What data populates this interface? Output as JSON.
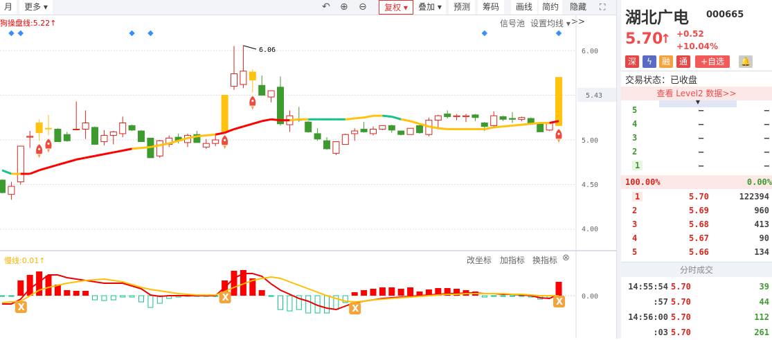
{
  "toolbar": {
    "period_month": "月",
    "more": "更多",
    "adjust": "复权",
    "overlay": "叠加",
    "forecast": "预测",
    "chips": "筹码",
    "draw": "画线",
    "simple": "简约",
    "hide": "隐藏>>",
    "icons": [
      "undo-icon",
      "zoom-in-icon",
      "zoom-out-icon",
      "fullscreen-icon"
    ]
  },
  "main_chart": {
    "indicator_label": "狗操盘线:5.22↑",
    "signal_pool": "信号池",
    "ma_settings": "设置均线",
    "max_label": "6.06",
    "current_price_label": "5.43",
    "colors": {
      "up": "#d9251c",
      "down": "#3d9a2f",
      "limit": "#ffc20e",
      "ma_up": "#ff0000",
      "ma_flat": "#ffc20e",
      "ma_down": "#13c38b",
      "signal": "#3b8cff"
    }
  },
  "lower_chart": {
    "label": "慢线:0.01↑",
    "change_axis": "改坐标",
    "add_indicator": "加指标",
    "switch_indicator": "换指标"
  },
  "chart_data": [
    {
      "type": "candlestick",
      "yticks": [
        "6.00",
        "5.00",
        "4.50",
        "4.00"
      ],
      "ylim": [
        3.8,
        6.2
      ],
      "candles": [
        [
          4.55,
          4.56,
          4.4,
          4.41,
          "d"
        ],
        [
          4.39,
          4.53,
          4.33,
          4.48,
          "u"
        ],
        [
          4.53,
          4.93,
          4.5,
          4.93,
          "u"
        ],
        [
          5.03,
          5.1,
          4.91,
          5.04,
          "u"
        ],
        [
          5.08,
          5.23,
          4.99,
          5.19,
          "l"
        ],
        [
          5.13,
          5.28,
          5.05,
          5.13,
          "l"
        ],
        [
          5.12,
          5.13,
          4.98,
          4.98,
          "d"
        ],
        [
          5.06,
          5.09,
          4.98,
          4.99,
          "d"
        ],
        [
          5.12,
          5.43,
          5.12,
          5.12,
          "u"
        ],
        [
          5.12,
          5.33,
          5.01,
          5.19,
          "u"
        ],
        [
          5.14,
          5.15,
          4.95,
          4.95,
          "d"
        ],
        [
          4.98,
          5.11,
          4.94,
          5.05,
          "u"
        ],
        [
          5.05,
          5.1,
          4.95,
          5.09,
          "u"
        ],
        [
          5.07,
          5.26,
          5.03,
          5.19,
          "u"
        ],
        [
          5.16,
          5.17,
          5.1,
          5.11,
          "d"
        ],
        [
          5.1,
          5.11,
          4.98,
          4.98,
          "d"
        ],
        [
          5.02,
          5.02,
          4.8,
          4.8,
          "d"
        ],
        [
          4.82,
          5.0,
          4.8,
          4.99,
          "u"
        ],
        [
          4.95,
          5.05,
          4.92,
          5.02,
          "u"
        ],
        [
          5.03,
          5.07,
          4.96,
          4.99,
          "d"
        ],
        [
          4.97,
          5.07,
          4.92,
          5.05,
          "u"
        ],
        [
          5.06,
          5.1,
          4.97,
          4.97,
          "d"
        ],
        [
          4.92,
          5.01,
          4.9,
          4.96,
          "u"
        ],
        [
          4.96,
          5.06,
          4.93,
          5.0,
          "u"
        ],
        [
          5.09,
          5.5,
          5.09,
          5.5,
          "l"
        ],
        [
          5.6,
          6.05,
          5.56,
          5.74,
          "u"
        ],
        [
          5.62,
          6.06,
          5.58,
          5.77,
          "u"
        ],
        [
          5.76,
          5.79,
          5.53,
          5.67,
          "l"
        ],
        [
          5.61,
          5.72,
          5.5,
          5.5,
          "d"
        ],
        [
          5.48,
          5.55,
          5.42,
          5.55,
          "u"
        ],
        [
          5.59,
          5.71,
          5.16,
          5.18,
          "d"
        ],
        [
          5.17,
          5.33,
          5.09,
          5.27,
          "u"
        ],
        [
          5.23,
          5.37,
          5.2,
          5.22,
          "d"
        ],
        [
          5.2,
          5.21,
          5.08,
          5.09,
          "d"
        ],
        [
          5.07,
          5.13,
          4.99,
          5.01,
          "d"
        ],
        [
          4.99,
          5.03,
          4.89,
          4.9,
          "d"
        ],
        [
          4.85,
          4.98,
          4.83,
          4.98,
          "u"
        ],
        [
          4.95,
          5.07,
          4.95,
          5.06,
          "u"
        ],
        [
          5.07,
          5.13,
          4.99,
          5.1,
          "u"
        ],
        [
          5.12,
          5.2,
          5.08,
          5.09,
          "d"
        ],
        [
          5.07,
          5.15,
          5.05,
          5.12,
          "u"
        ],
        [
          5.12,
          5.16,
          5.11,
          5.16,
          "u"
        ],
        [
          5.16,
          5.17,
          5.08,
          5.11,
          "d"
        ],
        [
          5.1,
          5.1,
          5.05,
          5.06,
          "d"
        ],
        [
          5.06,
          5.13,
          5.06,
          5.13,
          "u"
        ],
        [
          5.16,
          5.17,
          5.07,
          5.08,
          "d"
        ],
        [
          5.06,
          5.25,
          5.04,
          5.22,
          "u"
        ],
        [
          5.22,
          5.28,
          5.14,
          5.27,
          "u"
        ],
        [
          5.29,
          5.33,
          5.24,
          5.26,
          "d"
        ],
        [
          5.26,
          5.29,
          5.22,
          5.27,
          "u"
        ],
        [
          5.26,
          5.29,
          5.2,
          5.27,
          "u"
        ],
        [
          5.28,
          5.29,
          5.21,
          5.25,
          "d"
        ],
        [
          5.19,
          5.2,
          5.1,
          5.15,
          "d"
        ],
        [
          5.16,
          5.32,
          5.13,
          5.27,
          "u"
        ],
        [
          5.26,
          5.27,
          5.21,
          5.23,
          "d"
        ],
        [
          5.24,
          5.31,
          5.19,
          5.23,
          "d"
        ],
        [
          5.23,
          5.26,
          5.21,
          5.25,
          "u"
        ],
        [
          5.24,
          5.25,
          5.17,
          5.19,
          "d"
        ],
        [
          5.19,
          5.19,
          5.09,
          5.09,
          "d"
        ],
        [
          5.11,
          5.19,
          5.1,
          5.19,
          "u"
        ],
        [
          5.16,
          5.7,
          5.16,
          5.7,
          "l"
        ]
      ],
      "ma": [
        4.66,
        4.62,
        4.62,
        4.62,
        4.66,
        4.69,
        4.72,
        4.75,
        4.78,
        4.8,
        4.82,
        4.84,
        4.86,
        4.88,
        4.9,
        4.91,
        4.92,
        4.94,
        4.96,
        4.99,
        5.02,
        5.04,
        5.05,
        5.06,
        5.08,
        5.12,
        5.15,
        5.18,
        5.21,
        5.23,
        5.22,
        5.22,
        5.23,
        5.23,
        5.23,
        5.23,
        5.23,
        5.23,
        5.24,
        5.25,
        5.27,
        5.27,
        5.26,
        5.23,
        5.21,
        5.18,
        5.15,
        5.13,
        5.12,
        5.12,
        5.12,
        5.12,
        5.12,
        5.14,
        5.15,
        5.16,
        5.17,
        5.18,
        5.19,
        5.19,
        5.21
      ],
      "ma_trend": "gyrrrrrrrrrrrryyyyyyyyyrrrrrrrryyggggyyyyggyyyyyyyyyyyyyyyyr",
      "signals": [
        1,
        2,
        14,
        16,
        52,
        60
      ],
      "rockets": [
        4,
        5,
        24,
        27,
        60
      ]
    },
    {
      "type": "macd",
      "yticks": [
        "0.00"
      ],
      "hist": [
        -0.002,
        -0.002,
        0.044,
        0.06,
        0.07,
        0.058,
        0.032,
        0.016,
        0.014,
        0.014,
        -0.012,
        -0.014,
        -0.012,
        -0.004,
        -0.004,
        -0.018,
        -0.034,
        -0.022,
        -0.008,
        -0.004,
        -0.002,
        -0.002,
        -0.002,
        -0.002,
        0.044,
        0.072,
        0.074,
        0.05,
        0.016,
        -0.002,
        -0.04,
        -0.044,
        -0.04,
        -0.05,
        -0.05,
        -0.05,
        -0.04,
        -0.02,
        0.01,
        0.016,
        0.02,
        0.024,
        0.024,
        0.02,
        0.024,
        0.012,
        0.018,
        0.022,
        0.022,
        0.02,
        0.016,
        0.012,
        -0.004,
        -0.002,
        -0.002,
        -0.002,
        -0.002,
        -0.004,
        -0.01,
        -0.006,
        0.04
      ],
      "fast": [
        -0.024,
        -0.024,
        -0.01,
        0.02,
        0.04,
        0.06,
        0.06,
        0.052,
        0.048,
        0.044,
        0.04,
        0.036,
        0.036,
        0.036,
        0.028,
        0.02,
        0.002,
        -0.002,
        0,
        0,
        0,
        0,
        0,
        0,
        0.024,
        0.05,
        0.064,
        0.064,
        0.056,
        0.034,
        0.016,
        0.004,
        -0.008,
        -0.016,
        -0.028,
        -0.036,
        -0.04,
        -0.03,
        -0.02,
        -0.016,
        -0.012,
        -0.008,
        -0.006,
        -0.004,
        -0.002,
        0,
        0.002,
        0.004,
        0.006,
        0.006,
        0.008,
        0.008,
        0.006,
        0.006,
        0.004,
        0.004,
        0.002,
        0,
        -0.006,
        -0.008,
        0.004
      ],
      "slow": [
        -0.02,
        -0.018,
        -0.016,
        0,
        0.016,
        0.024,
        0.03,
        0.036,
        0.04,
        0.044,
        0.046,
        0.048,
        0.044,
        0.04,
        0.032,
        0.024,
        0.018,
        0.014,
        0.01,
        0.006,
        0.004,
        0.002,
        0.002,
        0.002,
        0.012,
        0.024,
        0.034,
        0.044,
        0.05,
        0.054,
        0.05,
        0.04,
        0.03,
        0.02,
        0.01,
        0,
        -0.008,
        -0.016,
        -0.018,
        -0.016,
        -0.012,
        -0.01,
        -0.008,
        -0.006,
        -0.004,
        -0.002,
        0,
        0.002,
        0.004,
        0.004,
        0.006,
        0.006,
        0.006,
        0.006,
        0.006,
        0.004,
        0.004,
        0.002,
        0,
        0,
        0
      ],
      "cross_markers": [
        2,
        24,
        38,
        60
      ]
    }
  ],
  "stock": {
    "name": "湖北广电",
    "code": "000665",
    "price": "5.70",
    "arrow": "↑",
    "change": "+0.52",
    "change_pct": "+10.04%",
    "tags": [
      "深",
      "融",
      "通"
    ],
    "add_watch": "+自选",
    "status": "交易状态：已收盘",
    "level2": "查看 Level2 数据>>"
  },
  "order_book": {
    "asks": [
      {
        "level": "5",
        "price": "—",
        "vol": "—"
      },
      {
        "level": "4",
        "price": "—",
        "vol": "—"
      },
      {
        "level": "3",
        "price": "—",
        "vol": "—"
      },
      {
        "level": "2",
        "price": "—",
        "vol": "—"
      },
      {
        "level": "1",
        "price": "—",
        "vol": "—"
      }
    ],
    "buy_ratio": "100.00%",
    "sell_ratio": "0.00%",
    "bids": [
      {
        "level": "1",
        "price": "5.70",
        "vol": "122394"
      },
      {
        "level": "2",
        "price": "5.69",
        "vol": "960"
      },
      {
        "level": "3",
        "price": "5.68",
        "vol": "413"
      },
      {
        "level": "4",
        "price": "5.67",
        "vol": "90"
      },
      {
        "level": "5",
        "price": "5.66",
        "vol": "134"
      }
    ]
  },
  "ticks": {
    "title": "分时成交",
    "rows": [
      {
        "time": "14:55:54",
        "price": "5.70",
        "vol": "39"
      },
      {
        "time": ":57",
        "price": "5.70",
        "vol": "44"
      },
      {
        "time": "14:56:00",
        "price": "5.70",
        "vol": "112"
      },
      {
        "time": ":03",
        "price": "5.70",
        "vol": "261"
      }
    ]
  }
}
